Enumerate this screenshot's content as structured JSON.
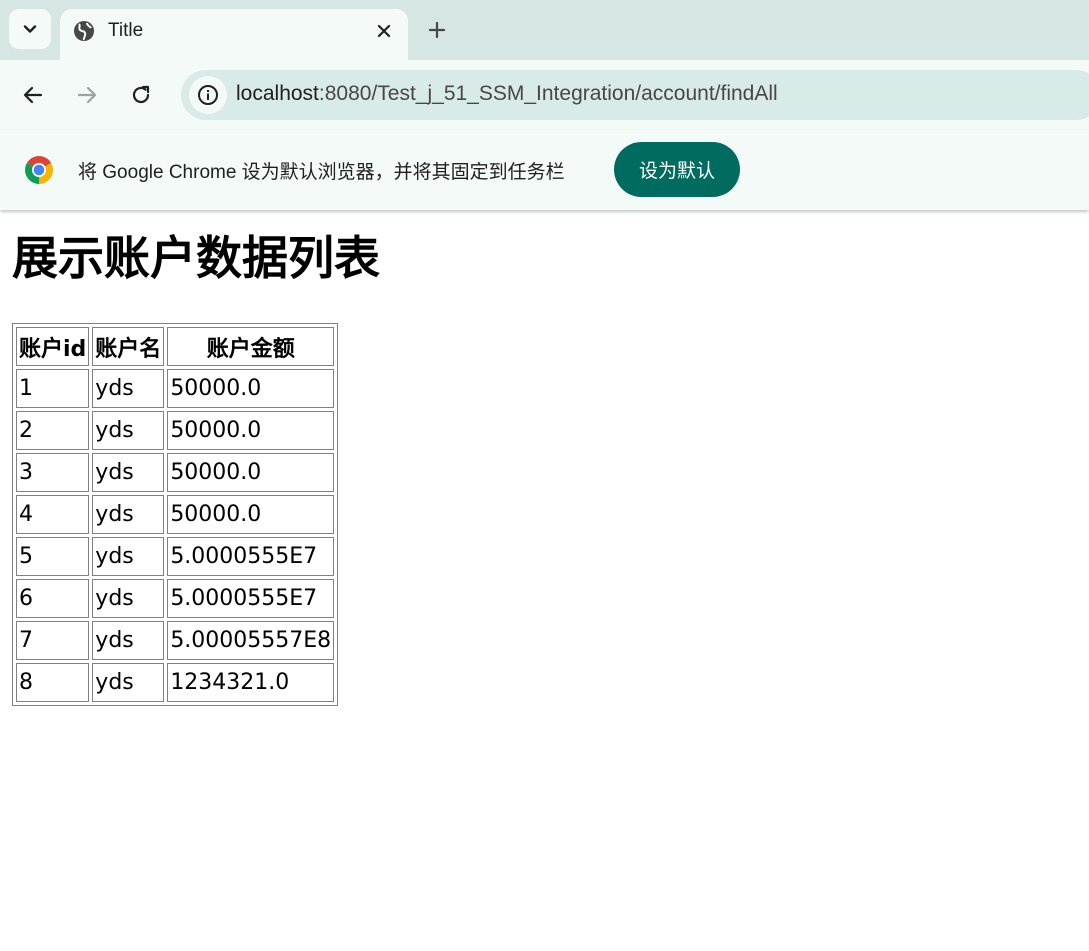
{
  "browser": {
    "tab": {
      "title": "Title"
    },
    "url": {
      "host": "localhost",
      "path": ":8080/Test_j_51_SSM_Integration/account/findAll"
    },
    "infobar": {
      "message": "将 Google Chrome 设为默认浏览器，并将其固定到任务栏",
      "button_label": "设为默认"
    }
  },
  "page": {
    "heading": "展示账户数据列表",
    "table": {
      "headers": [
        "账户id",
        "账户名",
        "账户金额"
      ],
      "rows": [
        [
          "1",
          "yds",
          "50000.0"
        ],
        [
          "2",
          "yds",
          "50000.0"
        ],
        [
          "3",
          "yds",
          "50000.0"
        ],
        [
          "4",
          "yds",
          "50000.0"
        ],
        [
          "5",
          "yds",
          "5.0000555E7"
        ],
        [
          "6",
          "yds",
          "5.0000555E7"
        ],
        [
          "7",
          "yds",
          "5.00005557E8"
        ],
        [
          "8",
          "yds",
          "1234321.0"
        ]
      ]
    }
  },
  "icons": {
    "tab_search": "chevron-down-icon",
    "favicon": "globe-icon",
    "close": "close-icon",
    "new_tab": "plus-icon",
    "back": "arrow-left-icon",
    "forward": "arrow-right-icon",
    "reload": "reload-icon",
    "site_info": "info-icon",
    "chrome_logo": "chrome-logo-icon"
  },
  "colors": {
    "tabstrip": "#d6e6e2",
    "toolbar": "#f4faf8",
    "omnibox": "#d8ebe6",
    "accent_button": "#006b5f"
  }
}
